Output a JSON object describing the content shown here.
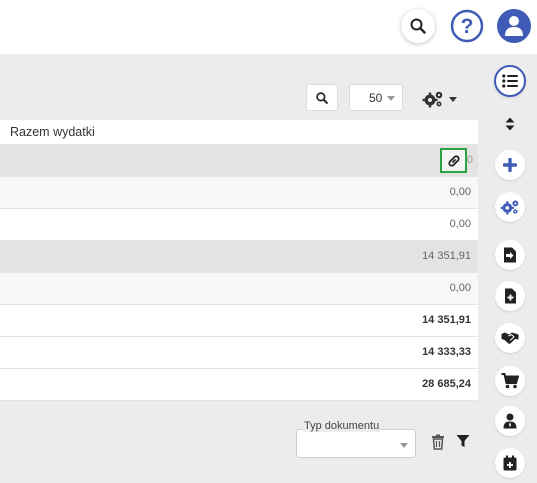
{
  "topbar": {
    "icons": [
      "search-icon",
      "help-icon",
      "user-icon"
    ]
  },
  "toolbar": {
    "page_size": "50",
    "icons": [
      "search-icon",
      "settings-icon",
      "chevron-down-icon"
    ]
  },
  "table": {
    "header": "Razem wydatki",
    "rows": [
      {
        "value": "0",
        "style": "grey"
      },
      {
        "value": "0,00",
        "style": "light"
      },
      {
        "value": "0,00",
        "style": "white"
      },
      {
        "value": "14 351,91",
        "style": "grey"
      },
      {
        "value": "0,00",
        "style": "light"
      },
      {
        "value": "14 351,91",
        "style": "white"
      },
      {
        "value": "14 333,33",
        "style": "white"
      },
      {
        "value": "28 685,24",
        "style": "white"
      }
    ]
  },
  "filter": {
    "label": "Typ dokumentu",
    "value": ""
  },
  "colors": {
    "accent": "#3f5bb5",
    "highlight": "#2aa342"
  },
  "sidebar": {
    "icons": [
      "list-icon",
      "sort-icon",
      "plus-icon",
      "settings-icon",
      "import-icon",
      "new-document-icon",
      "handshake-icon",
      "cart-icon",
      "person-icon",
      "calendar-add-icon"
    ]
  }
}
